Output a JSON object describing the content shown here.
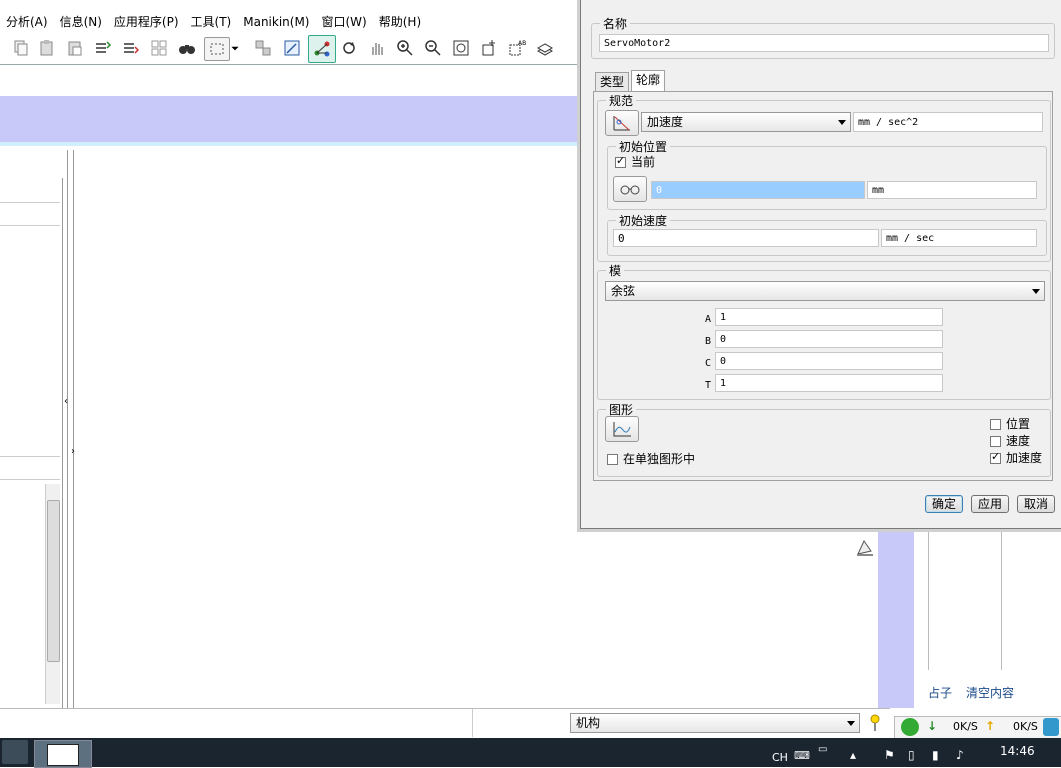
{
  "menu": [
    "分析(A)",
    "信息(N)",
    "应用程序(P)",
    "工具(T)",
    "Manikin(M)",
    "窗口(W)",
    "帮助(H)"
  ],
  "dialog": {
    "name_label": "名称",
    "name_value": "ServoMotor2",
    "tabs": [
      "类型",
      "轮廓"
    ],
    "spec": {
      "legend": "规范",
      "select_value": "加速度",
      "unit": "mm / sec^2"
    },
    "init_pos": {
      "legend": "初始位置",
      "current_label": "当前",
      "current_checked": true,
      "value": "0",
      "unit": "mm"
    },
    "init_vel": {
      "legend": "初始速度",
      "value": "0",
      "unit": "mm / sec"
    },
    "model": {
      "legend": "模",
      "select_value": "余弦",
      "params": [
        {
          "label": "A",
          "value": "1"
        },
        {
          "label": "B",
          "value": "0"
        },
        {
          "label": "C",
          "value": "0"
        },
        {
          "label": "T",
          "value": "1"
        }
      ]
    },
    "graph": {
      "legend": "图形",
      "separate_label": "在单独图形中",
      "separate_checked": false,
      "options": [
        {
          "label": "位置",
          "checked": false
        },
        {
          "label": "速度",
          "checked": false
        },
        {
          "label": "加速度",
          "checked": true
        }
      ]
    },
    "buttons": {
      "ok": "确定",
      "apply": "应用",
      "cancel": "取消"
    }
  },
  "bottom": {
    "mechanism_select": "机构",
    "right_links": [
      "占子",
      "清空内容"
    ]
  },
  "tray": {
    "download": "0K/S",
    "upload": "0K/S",
    "lang": "CH",
    "time": "14:46"
  },
  "colors": {
    "lavender": "#c9c9f9",
    "selection": "#99ccff",
    "taskbar": "#1a2530"
  }
}
